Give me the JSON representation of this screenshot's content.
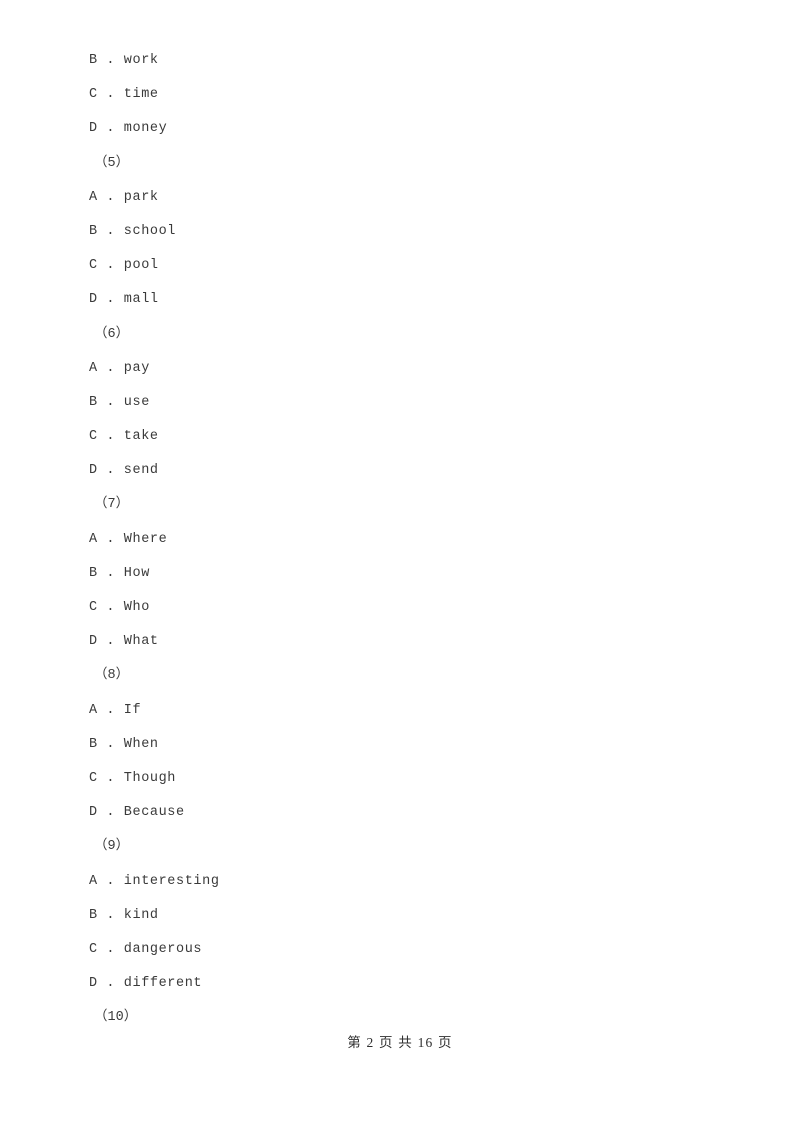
{
  "document": {
    "page_background": "#ffffff",
    "text_color": "#3a3a3a",
    "footer_color": "#2e2e2e"
  },
  "lines": [
    {
      "kind": "option",
      "letter": "B",
      "sep": " . ",
      "text": "work",
      "full": "B . work"
    },
    {
      "kind": "option",
      "letter": "C",
      "sep": " . ",
      "text": "time",
      "full": "C . time"
    },
    {
      "kind": "option",
      "letter": "D",
      "sep": " . ",
      "text": "money",
      "full": "D . money"
    },
    {
      "kind": "qnumber",
      "text": "（5）",
      "full": "（5）"
    },
    {
      "kind": "option",
      "letter": "A",
      "sep": " . ",
      "text": "park",
      "full": "A . park"
    },
    {
      "kind": "option",
      "letter": "B",
      "sep": " . ",
      "text": "school",
      "full": "B . school"
    },
    {
      "kind": "option",
      "letter": "C",
      "sep": " . ",
      "text": "pool",
      "full": "C . pool"
    },
    {
      "kind": "option",
      "letter": "D",
      "sep": " . ",
      "text": "mall",
      "full": "D . mall"
    },
    {
      "kind": "qnumber",
      "text": "（6）",
      "full": "（6）"
    },
    {
      "kind": "option",
      "letter": "A",
      "sep": " . ",
      "text": "pay",
      "full": "A . pay"
    },
    {
      "kind": "option",
      "letter": "B",
      "sep": " . ",
      "text": "use",
      "full": "B . use"
    },
    {
      "kind": "option",
      "letter": "C",
      "sep": " . ",
      "text": "take",
      "full": "C . take"
    },
    {
      "kind": "option",
      "letter": "D",
      "sep": " . ",
      "text": "send",
      "full": "D . send"
    },
    {
      "kind": "qnumber",
      "text": "（7）",
      "full": "（7）"
    },
    {
      "kind": "option",
      "letter": "A",
      "sep": " . ",
      "text": "Where",
      "full": "A . Where"
    },
    {
      "kind": "option",
      "letter": "B",
      "sep": " . ",
      "text": "How",
      "full": "B . How"
    },
    {
      "kind": "option",
      "letter": "C",
      "sep": " . ",
      "text": "Who",
      "full": "C . Who"
    },
    {
      "kind": "option",
      "letter": "D",
      "sep": " . ",
      "text": "What",
      "full": "D . What"
    },
    {
      "kind": "qnumber",
      "text": "（8）",
      "full": "（8）"
    },
    {
      "kind": "option",
      "letter": "A",
      "sep": " . ",
      "text": "If",
      "full": "A . If"
    },
    {
      "kind": "option",
      "letter": "B",
      "sep": " . ",
      "text": "When",
      "full": "B . When"
    },
    {
      "kind": "option",
      "letter": "C",
      "sep": " . ",
      "text": "Though",
      "full": "C . Though"
    },
    {
      "kind": "option",
      "letter": "D",
      "sep": " . ",
      "text": "Because",
      "full": "D . Because"
    },
    {
      "kind": "qnumber",
      "text": "（9）",
      "full": "（9）"
    },
    {
      "kind": "option",
      "letter": "A",
      "sep": " . ",
      "text": "interesting",
      "full": "A . interesting"
    },
    {
      "kind": "option",
      "letter": "B",
      "sep": " . ",
      "text": "kind",
      "full": "B . kind"
    },
    {
      "kind": "option",
      "letter": "C",
      "sep": " . ",
      "text": "dangerous",
      "full": "C . dangerous"
    },
    {
      "kind": "option",
      "letter": "D",
      "sep": " . ",
      "text": "different",
      "full": "D . different"
    },
    {
      "kind": "qnumber",
      "text": "（10）",
      "full": "（10）"
    }
  ],
  "footer": {
    "text": "第 2 页 共 16 页",
    "current_page": "2",
    "total_pages": "16"
  }
}
